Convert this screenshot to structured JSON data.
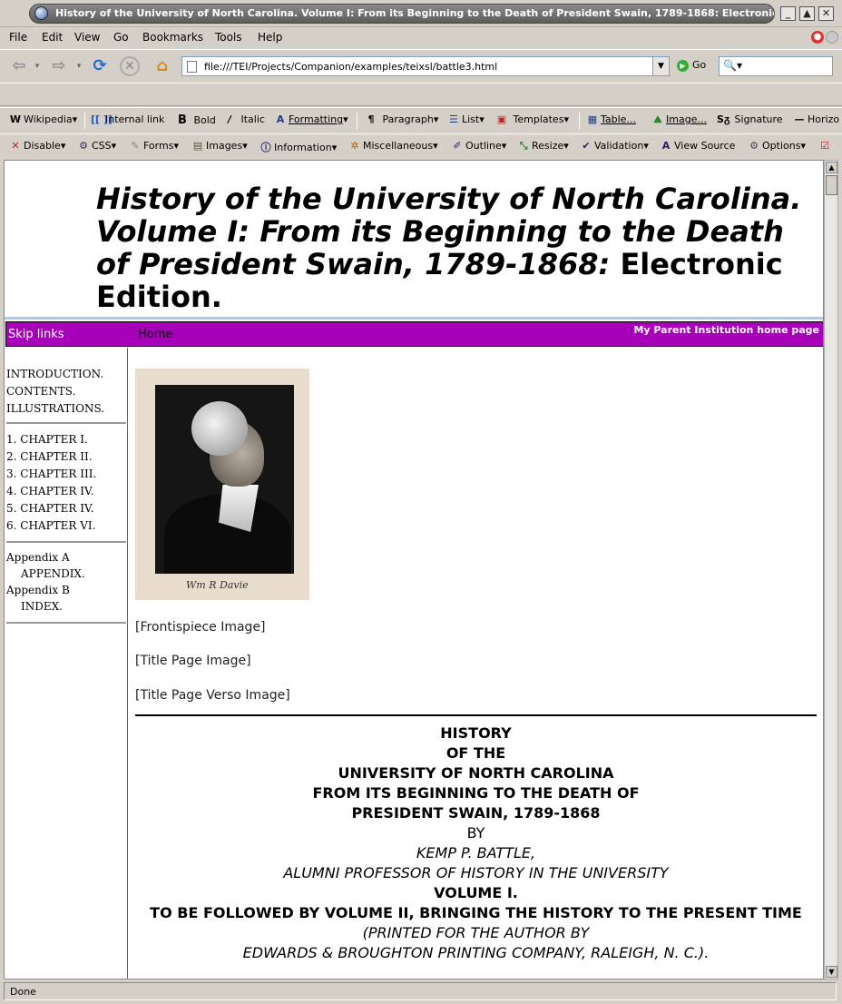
{
  "window": {
    "title": "History of the University of North Carolina. Volume I: From its Beginning to the Death of President Swain, 1789-1868: Electronic Edition. - Mozilla Firefox"
  },
  "menu": [
    "File",
    "Edit",
    "View",
    "Go",
    "Bookmarks",
    "Tools",
    "Help"
  ],
  "nav": {
    "url": "file:///TEI/Projects/Companion/examples/teixsl/battle3.html",
    "go_label": "Go"
  },
  "wiki_toolbar": {
    "wikipedia": "Wikipedia",
    "internal_link": "Internal link",
    "bold": "Bold",
    "italic": "Italic",
    "formatting": "Formatting",
    "paragraph": "Paragraph",
    "list": "List",
    "templates": "Templates",
    "table": "Table...",
    "image": "Image...",
    "signature": "Signature",
    "horizontal": "Horizo"
  },
  "dev_toolbar": {
    "disable": "Disable",
    "css": "CSS",
    "forms": "Forms",
    "images": "Images",
    "information": "Information",
    "miscellaneous": "Miscellaneous",
    "outline": "Outline",
    "resize": "Resize",
    "validation": "Validation",
    "view_source": "View Source",
    "options": "Options"
  },
  "page": {
    "title_italic": "History of the University of North Carolina. Volume I: From its Beginning to the Death of President Swain, 1789-1868:",
    "title_plain": "Electronic Edition.",
    "purplebar": {
      "skip": "Skip links",
      "home": "Home",
      "institution": "My Parent Institution home page"
    },
    "leftnav": {
      "front": [
        "INTRODUCTION.",
        "CONTENTS.",
        "ILLUSTRATIONS."
      ],
      "chapters": [
        "1.  CHAPTER I.",
        "2.  CHAPTER II.",
        "3.  CHAPTER III.",
        "4.  CHAPTER IV.",
        "5.  CHAPTER IV.",
        "6.  CHAPTER VI."
      ],
      "appendices": [
        {
          "label": "Appendix A",
          "title": "APPENDIX."
        },
        {
          "label": "Appendix B",
          "title": "INDEX."
        }
      ]
    },
    "portrait_signature": "Wm R Davie",
    "image_links": [
      "[Frontispiece Image]",
      "[Title Page Image]",
      "[Title Page Verso Image]"
    ],
    "titlepage": {
      "l1": "HISTORY",
      "l2": "OF THE",
      "l3": "UNIVERSITY OF NORTH CAROLINA",
      "l4": "FROM ITS BEGINNING TO THE DEATH OF",
      "l5": "PRESIDENT SWAIN, 1789-1868",
      "l6": "BY",
      "l7": "KEMP P. BATTLE,",
      "l8": "ALUMNI PROFESSOR OF HISTORY IN THE UNIVERSITY",
      "l9": "VOLUME I.",
      "l10": "TO BE FOLLOWED BY VOLUME II, BRINGING THE HISTORY TO THE PRESENT TIME",
      "l11": "(PRINTED FOR THE AUTHOR BY",
      "l12": "EDWARDS & BROUGHTON PRINTING COMPANY, RALEIGH, N. C.)."
    }
  },
  "status": "Done"
}
